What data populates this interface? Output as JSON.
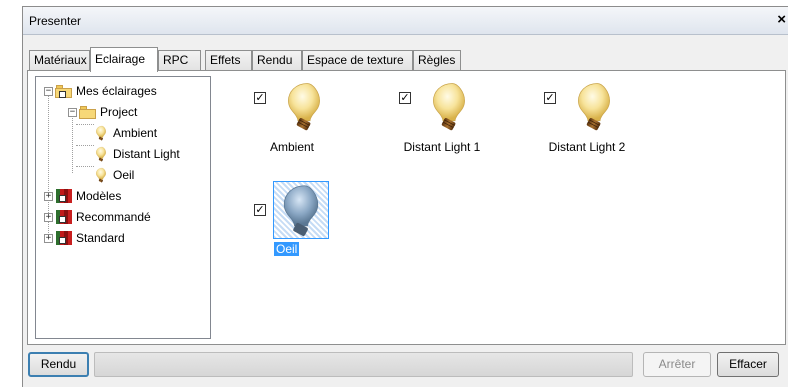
{
  "window": {
    "title": "Presenter",
    "close_label": "×"
  },
  "tabs": [
    {
      "label": "Matériaux",
      "active": false
    },
    {
      "label": "Eclairage",
      "active": true
    },
    {
      "label": "RPC",
      "active": false
    },
    {
      "label": "Effets",
      "active": false
    },
    {
      "label": "Rendu",
      "active": false
    },
    {
      "label": "Espace de texture",
      "active": false
    },
    {
      "label": "Règles",
      "active": false
    }
  ],
  "tree": {
    "root": {
      "label": "Mes éclairages",
      "expanded": true
    },
    "project": {
      "label": "Project",
      "expanded": true
    },
    "lights": [
      {
        "label": "Ambient"
      },
      {
        "label": "Distant Light"
      },
      {
        "label": "Oeil"
      }
    ],
    "libraries": [
      {
        "label": "Modèles",
        "expanded": false
      },
      {
        "label": "Recommandé",
        "expanded": false
      },
      {
        "label": "Standard",
        "expanded": false
      }
    ]
  },
  "lights": [
    {
      "label": "Ambient",
      "checked": true,
      "selected": false,
      "icon": "light-bulb-icon"
    },
    {
      "label": "Distant Light 1",
      "checked": true,
      "selected": false,
      "icon": "light-bulb-icon"
    },
    {
      "label": "Distant Light 2",
      "checked": true,
      "selected": false,
      "icon": "light-bulb-icon"
    },
    {
      "label": "Oeil",
      "checked": true,
      "selected": true,
      "icon": "light-bulb-icon"
    }
  ],
  "buttons": {
    "render": "Rendu",
    "stop": "Arrêter",
    "clear": "Effacer"
  },
  "progress": {
    "value": 0
  },
  "colors": {
    "selection": "#3399ff",
    "bulb_glass": "#f7e39a",
    "bulb_base": "#7a4a1a"
  }
}
